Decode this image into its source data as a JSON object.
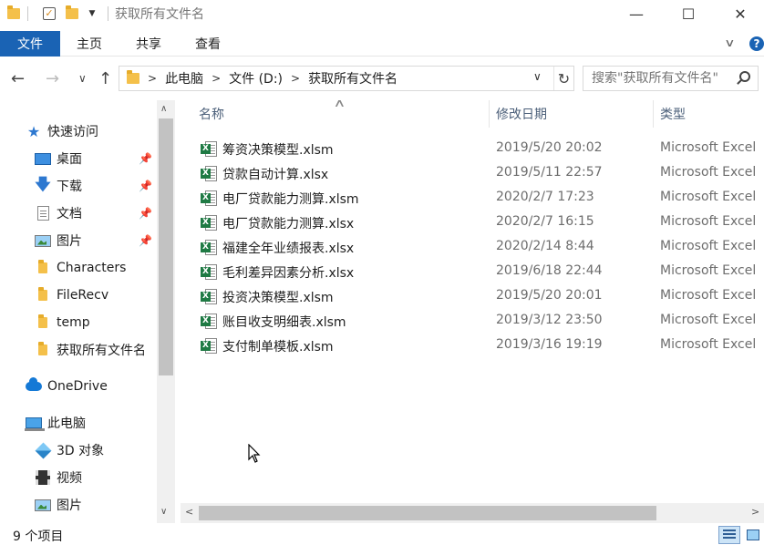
{
  "window": {
    "title": "获取所有文件名",
    "minimize": "—",
    "maximize": "☐",
    "close": "✕"
  },
  "ribbon": {
    "tabs": [
      "文件",
      "主页",
      "共享",
      "查看"
    ],
    "collapse": "∨",
    "help": "?"
  },
  "nav": {
    "back": "←",
    "forward": "→",
    "recent": "∨",
    "up": "↑",
    "breadcrumb": [
      "此电脑",
      "文件 (D:)",
      "获取所有文件名"
    ],
    "refresh": "↻",
    "search_placeholder": "搜索\"获取所有文件名\""
  },
  "sidebar": {
    "quick_access": "快速访问",
    "items": [
      {
        "label": "桌面",
        "icon": "desktop-icon",
        "pinned": true
      },
      {
        "label": "下载",
        "icon": "download-icon",
        "pinned": true
      },
      {
        "label": "文档",
        "icon": "document-icon",
        "pinned": true
      },
      {
        "label": "图片",
        "icon": "pictures-icon",
        "pinned": true
      },
      {
        "label": "Characters",
        "icon": "folder-icon",
        "pinned": false
      },
      {
        "label": "FileRecv",
        "icon": "folder-icon",
        "pinned": false
      },
      {
        "label": "temp",
        "icon": "folder-icon",
        "pinned": false
      },
      {
        "label": "获取所有文件名",
        "icon": "folder-icon",
        "pinned": false
      }
    ],
    "onedrive": "OneDrive",
    "this_pc": "此电脑",
    "pc_items": [
      {
        "label": "3D 对象",
        "icon": "3d-objects-icon"
      },
      {
        "label": "视频",
        "icon": "video-icon"
      },
      {
        "label": "图片",
        "icon": "pictures-icon"
      }
    ]
  },
  "columns": {
    "name": "名称",
    "date": "修改日期",
    "type": "类型"
  },
  "files": [
    {
      "name": "筹资决策模型.xlsm",
      "date": "2019/5/20 20:02",
      "type": "Microsoft Excel"
    },
    {
      "name": "贷款自动计算.xlsx",
      "date": "2019/5/11 22:57",
      "type": "Microsoft Excel"
    },
    {
      "name": "电厂贷款能力测算.xlsm",
      "date": "2020/2/7 17:23",
      "type": "Microsoft Excel"
    },
    {
      "name": "电厂贷款能力测算.xlsx",
      "date": "2020/2/7 16:15",
      "type": "Microsoft Excel"
    },
    {
      "name": "福建全年业绩报表.xlsx",
      "date": "2020/2/14 8:44",
      "type": "Microsoft Excel"
    },
    {
      "name": "毛利差异因素分析.xlsx",
      "date": "2019/6/18 22:44",
      "type": "Microsoft Excel"
    },
    {
      "name": "投资决策模型.xlsm",
      "date": "2019/5/20 20:01",
      "type": "Microsoft Excel"
    },
    {
      "name": "账目收支明细表.xlsm",
      "date": "2019/3/12 23:50",
      "type": "Microsoft Excel"
    },
    {
      "name": "支付制单模板.xlsm",
      "date": "2019/3/16 19:19",
      "type": "Microsoft Excel"
    }
  ],
  "status": {
    "count": "9 个项目"
  }
}
